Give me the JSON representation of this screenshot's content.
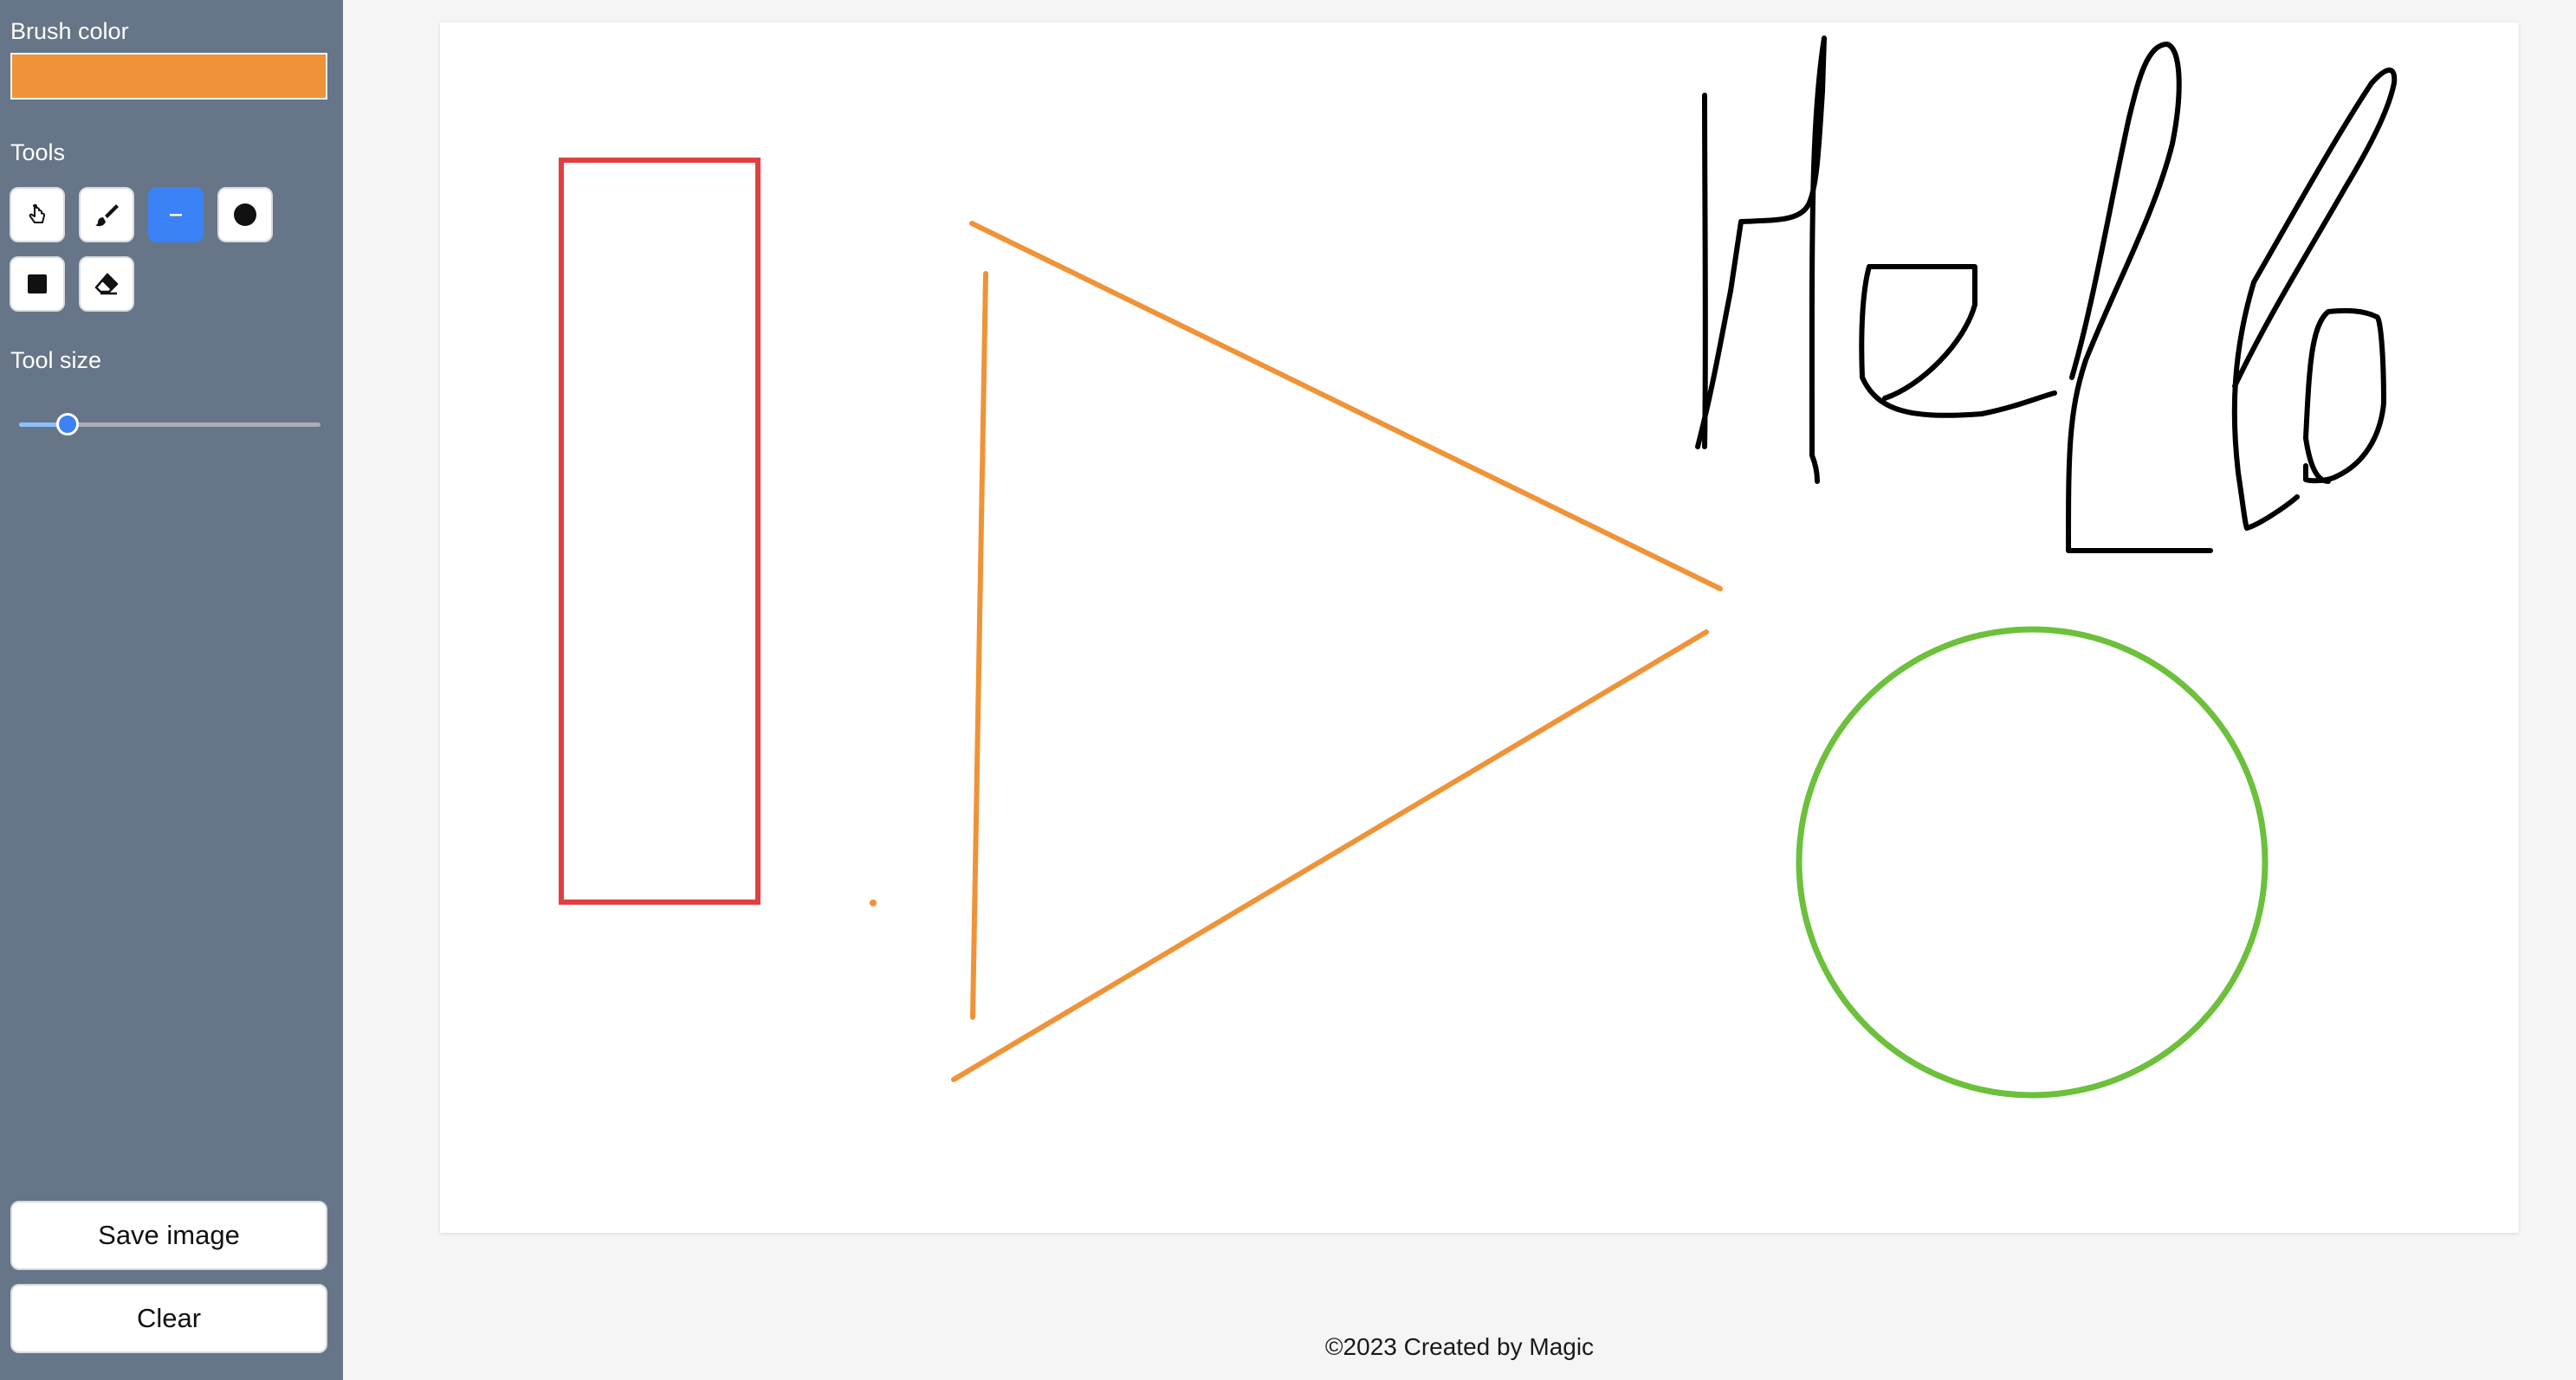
{
  "sidebar": {
    "brush_color_label": "Brush color",
    "brush_color": "#ef9338",
    "tools_label": "Tools",
    "tools": [
      {
        "name": "select",
        "icon": "hand-pointer-icon",
        "active": false
      },
      {
        "name": "brush",
        "icon": "brush-icon",
        "active": false
      },
      {
        "name": "line",
        "icon": "line-icon",
        "active": true
      },
      {
        "name": "circle",
        "icon": "circle-icon",
        "active": false
      },
      {
        "name": "rectangle",
        "icon": "square-icon",
        "active": false
      },
      {
        "name": "eraser",
        "icon": "eraser-icon",
        "active": false
      }
    ],
    "tool_size_label": "Tool size",
    "tool_size_fraction": 0.16,
    "save_label": "Save image",
    "clear_label": "Clear"
  },
  "colors": {
    "sidebar_bg": "#667587",
    "active_tool": "#3b82f6",
    "rectangle_stroke": "#e04040",
    "triangle_stroke": "#ef9338",
    "circle_stroke": "#6cc03c",
    "text_stroke": "#000000"
  },
  "canvas": {
    "drawn_text_handwritten": "Hello"
  },
  "footer": {
    "text": "©2023 Created by Magic"
  }
}
